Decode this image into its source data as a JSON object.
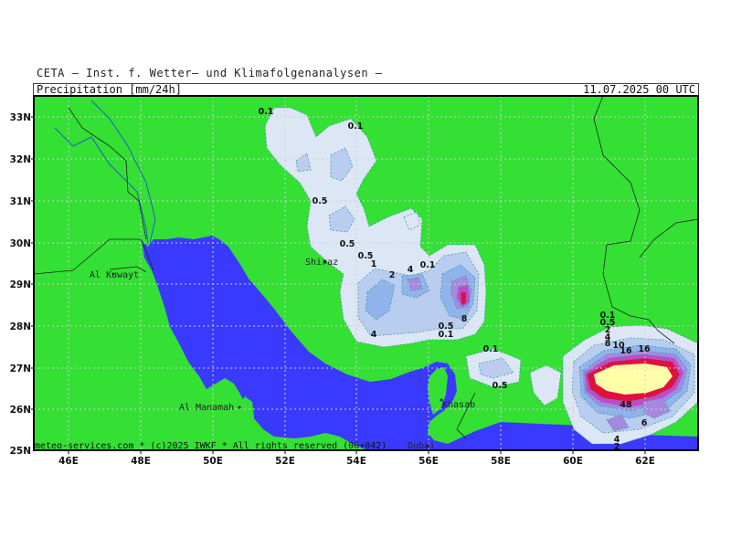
{
  "header": {
    "institute": "CETA — Inst. f. Wetter— und Klimafolgenanalysen —",
    "field": "Precipitation [mm/24h]",
    "datetime": "11.07.2025 00 UTC"
  },
  "footer": {
    "credit": "meteo-services.com * (c)2025 IWKF * All rights reserved (06+042)"
  },
  "axes": {
    "lat_labels": [
      "33N",
      "32N",
      "31N",
      "30N",
      "29N",
      "28N",
      "27N",
      "26N",
      "25N"
    ],
    "lon_labels": [
      "46E",
      "48E",
      "50E",
      "52E",
      "54E",
      "56E",
      "58E",
      "60E",
      "62E"
    ]
  },
  "places": [
    {
      "name": "Al Kuwayt"
    },
    {
      "name": "Shiraz"
    },
    {
      "name": "Al Manamah"
    },
    {
      "name": "Khasab"
    },
    {
      "name": "Dubai"
    }
  ],
  "contour_labels": [
    "0.1",
    "0.1",
    "0.5",
    "0.5",
    "0.5",
    "1",
    "2",
    "4",
    "0.1",
    "8",
    "0.5",
    "0.1",
    "4",
    "0.1",
    "0.5",
    "0.1",
    "0.5",
    "2",
    "4",
    "8",
    "10",
    "16",
    "16",
    "48",
    "6",
    "4",
    "2"
  ],
  "legend_colors": {
    "land": "#33e033",
    "sea": "#3a3aff",
    "precip_0_1": "#dce6f5",
    "precip_0_5": "#b8cdf0",
    "precip_1": "#8fb3ea",
    "precip_4": "#a788e0",
    "precip_8": "#c845d0",
    "precip_16": "#e01040",
    "precip_max": "#ffffa8"
  }
}
